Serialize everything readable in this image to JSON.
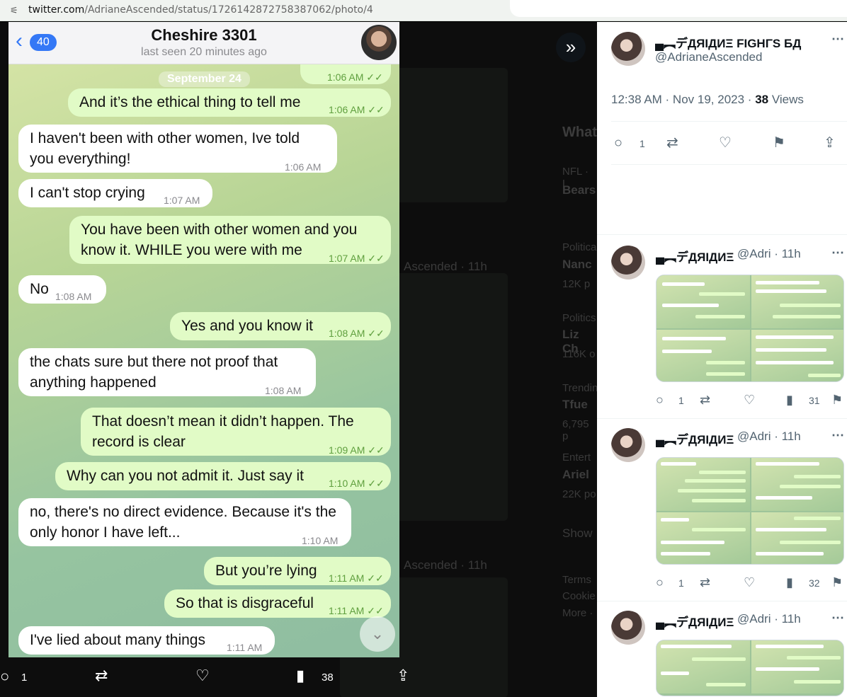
{
  "browser": {
    "url_domain": "twitter.com",
    "url_path": "/AdrianeAscended/status/1726142872758387062/photo/4"
  },
  "chat": {
    "contact_name": "Cheshire 3301",
    "last_seen": "last seen 20 minutes ago",
    "unread_count": "40",
    "date_chip": "September 24",
    "messages": [
      {
        "dir": "out",
        "text": "",
        "time": "1:06 AM"
      },
      {
        "dir": "out",
        "text": "And it’s the ethical thing to tell me",
        "time": "1:06 AM"
      },
      {
        "dir": "in",
        "text": "I haven't been with other women, Ive told you everything!",
        "time": "1:06 AM"
      },
      {
        "dir": "in",
        "text": "I can't stop crying",
        "time": "1:07 AM"
      },
      {
        "dir": "out",
        "text": "You have been with other women and you know it. WHILE you were with me",
        "time": "1:07 AM"
      },
      {
        "dir": "in",
        "text": "No",
        "time": "1:08 AM"
      },
      {
        "dir": "out",
        "text": "Yes and you know it",
        "time": "1:08 AM"
      },
      {
        "dir": "in",
        "text": "the chats sure but there not proof that anything happened",
        "time": "1:08 AM"
      },
      {
        "dir": "out",
        "text": "That doesn’t mean it didn’t happen. The record is clear",
        "time": "1:09 AM"
      },
      {
        "dir": "out",
        "text": "Why can you not admit it. Just say it",
        "time": "1:10 AM"
      },
      {
        "dir": "in",
        "text": "no, there's no direct evidence. Because it's the only honor I have left...",
        "time": "1:10 AM"
      },
      {
        "dir": "out",
        "text": "But you’re lying",
        "time": "1:11 AM"
      },
      {
        "dir": "out",
        "text": "So that is disgraceful",
        "time": "1:11 AM"
      },
      {
        "dir": "in",
        "text": "I've lied about many things",
        "time": "1:11 AM"
      }
    ]
  },
  "media_bar": {
    "replies": "1",
    "views": "38"
  },
  "tweet": {
    "author_name": "▄︻デДЯIДИΞ FIGHΓЅ БД",
    "author_handle": "@AdrianeAscended",
    "time": "12:38 AM · Nov 19, 2023 ·",
    "views_count": "38",
    "views_label": "Views",
    "reply_count": "1"
  },
  "replies": [
    {
      "name": "▄︻デДЯIДИΞ",
      "handle": "@Adri · 11h",
      "reply_count": "1",
      "views": "31"
    },
    {
      "name": "▄︻デДЯIДИΞ",
      "handle": "@Adri · 11h",
      "reply_count": "1",
      "views": "32"
    },
    {
      "name": "▄︻デДЯIДИΞ",
      "handle": "@Adri · 11h"
    }
  ],
  "background_fragments": {
    "trend_heading": "What",
    "trend_1_cat": "NFL · L",
    "trend_1_name": "Bears",
    "trend_2_cat": "Politica",
    "trend_2_name": "Nanc",
    "trend_2_posts": "12K p",
    "trend_3_cat": "Politics",
    "trend_3_name": "Liz Ch",
    "trend_3_posts": "116K o",
    "trend_4_cat": "Trendin",
    "trend_4_name": "Tfue",
    "trend_4_posts": "6,795 p",
    "trend_5_cat": "Entert",
    "trend_5_name": "Ariel",
    "trend_5_posts": "22K po",
    "show_more": "Show",
    "footer_1": "Terms",
    "footer_2": "Cookie",
    "footer_3": "More ·",
    "bg_author_1": "Ascended · 11h",
    "bg_author_2": "Ascended · 11h"
  }
}
